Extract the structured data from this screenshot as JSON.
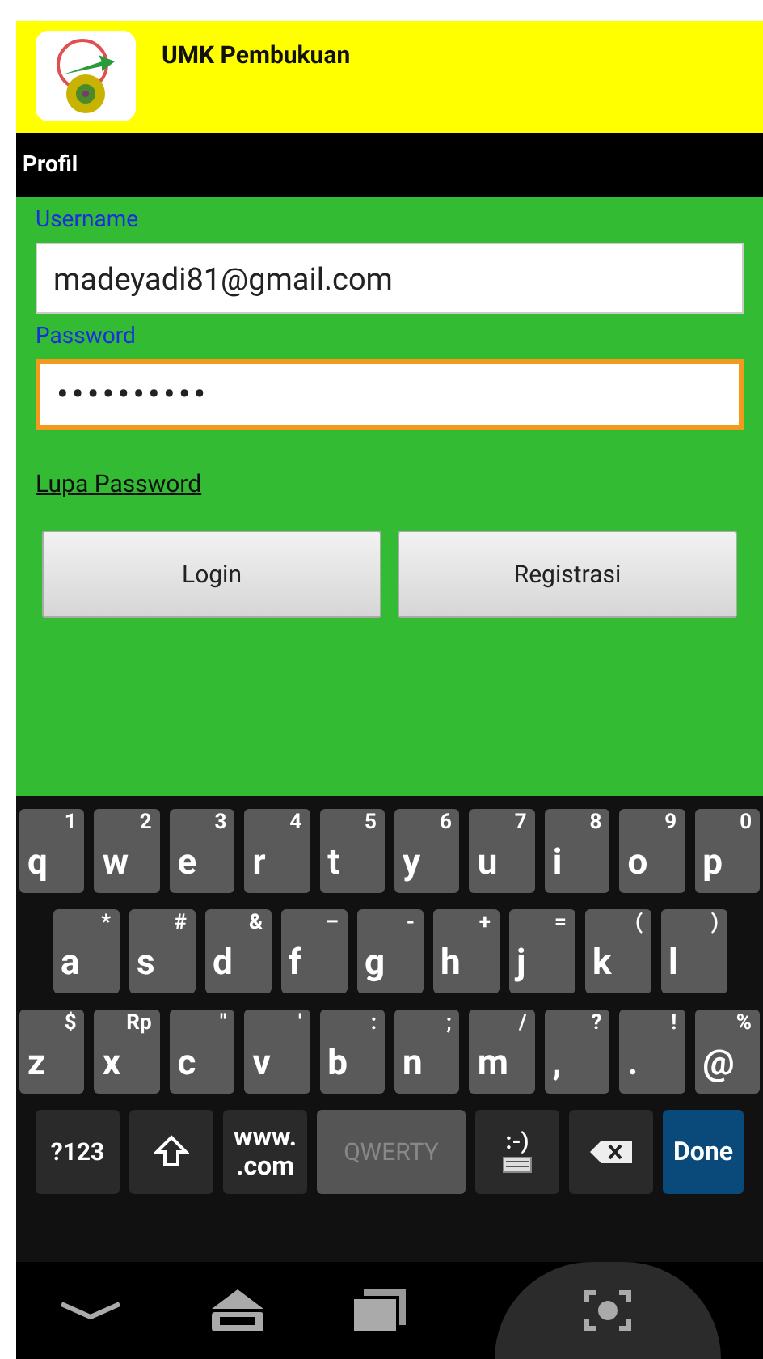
{
  "app_bar": {
    "title": "UMK Pembukuan"
  },
  "section_bar": {
    "title": "Profil"
  },
  "form": {
    "fields": [
      {
        "label": "Username",
        "value": "madeyadi81@gmail.com",
        "focused": false
      },
      {
        "label": "Password",
        "value": "••••••••••",
        "focused": true
      }
    ],
    "link": "Lupa Password",
    "buttons": [
      "Login",
      "Registrasi"
    ]
  },
  "keyboard": {
    "rows": [
      [
        {
          "main": "q",
          "alt": "1"
        },
        {
          "main": "w",
          "alt": "2"
        },
        {
          "main": "e",
          "alt": "3"
        },
        {
          "main": "r",
          "alt": "4"
        },
        {
          "main": "t",
          "alt": "5"
        },
        {
          "main": "y",
          "alt": "6"
        },
        {
          "main": "u",
          "alt": "7"
        },
        {
          "main": "i",
          "alt": "8"
        },
        {
          "main": "o",
          "alt": "9"
        },
        {
          "main": "p",
          "alt": "0"
        }
      ],
      [
        {
          "main": "a",
          "alt": "*"
        },
        {
          "main": "s",
          "alt": "#"
        },
        {
          "main": "d",
          "alt": "&"
        },
        {
          "main": "f",
          "alt": "–"
        },
        {
          "main": "g",
          "alt": "-"
        },
        {
          "main": "h",
          "alt": "+"
        },
        {
          "main": "j",
          "alt": "="
        },
        {
          "main": "k",
          "alt": "("
        },
        {
          "main": "l",
          "alt": ")"
        }
      ],
      [
        {
          "main": "z",
          "alt": "$"
        },
        {
          "main": "x",
          "alt": "Rp"
        },
        {
          "main": "c",
          "alt": "\""
        },
        {
          "main": "v",
          "alt": "'"
        },
        {
          "main": "b",
          "alt": ":"
        },
        {
          "main": "n",
          "alt": ";"
        },
        {
          "main": "m",
          "alt": "/"
        },
        {
          "main": ",",
          "alt": "?"
        },
        {
          "main": ".",
          "alt": "!"
        },
        {
          "main": "@",
          "alt": "%"
        }
      ]
    ],
    "bottom_row": [
      {
        "kind": "text",
        "label": "?123"
      },
      {
        "kind": "shift"
      },
      {
        "kind": "stack",
        "label": "www.",
        "label2": ".com"
      },
      {
        "kind": "space",
        "label": "QWERTY"
      },
      {
        "kind": "emoji",
        "label": ":-)"
      },
      {
        "kind": "backspace"
      },
      {
        "kind": "done",
        "label": "Done"
      }
    ]
  }
}
